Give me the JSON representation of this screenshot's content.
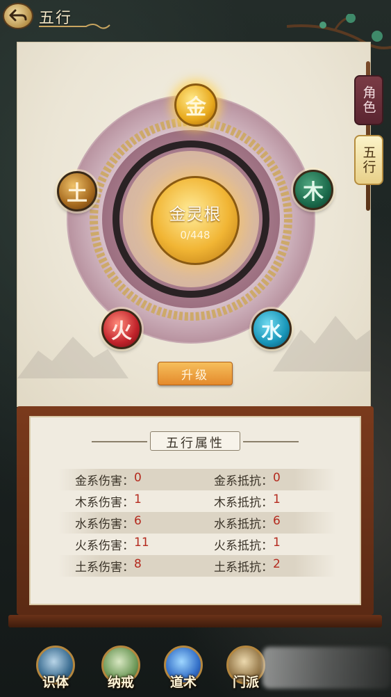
{
  "header": {
    "title": "五行",
    "back_icon": "back-arrow-icon"
  },
  "side_tabs": [
    {
      "label": "角色",
      "active": false
    },
    {
      "label": "五行",
      "active": true
    }
  ],
  "wheel": {
    "elements": {
      "gold": "金",
      "wood": "木",
      "water": "水",
      "fire": "火",
      "earth": "土"
    },
    "core": {
      "name": "金灵根",
      "progress": "0/448"
    }
  },
  "upgrade_label": "升级",
  "attributes": {
    "title": "五行属性",
    "rows": [
      {
        "dmg_label": "金系伤害：",
        "dmg_value": "0",
        "res_label": "金系抵抗：",
        "res_value": "0"
      },
      {
        "dmg_label": "木系伤害：",
        "dmg_value": "1",
        "res_label": "木系抵抗：",
        "res_value": "1"
      },
      {
        "dmg_label": "水系伤害：",
        "dmg_value": "6",
        "res_label": "水系抵抗：",
        "res_value": "6"
      },
      {
        "dmg_label": "火系伤害：",
        "dmg_value": "11",
        "res_label": "火系抵抗：",
        "res_value": "1"
      },
      {
        "dmg_label": "土系伤害：",
        "dmg_value": "8",
        "res_label": "土系抵抗：",
        "res_value": "2"
      }
    ]
  },
  "bottom_nav": [
    {
      "label": "识体",
      "icon": "character-icon"
    },
    {
      "label": "纳戒",
      "icon": "ring-icon"
    },
    {
      "label": "道术",
      "icon": "spell-icon"
    },
    {
      "label": "门派",
      "icon": "sect-icon"
    }
  ],
  "colors": {
    "gold_orb": "#e8a91d",
    "wood_orb": "#1b6a4b",
    "water_orb": "#1895b8",
    "fire_orb": "#c0222a",
    "earth_orb": "#a5691e",
    "value_red": "#b42a1e",
    "upgrade_button": "#e48a2c"
  }
}
